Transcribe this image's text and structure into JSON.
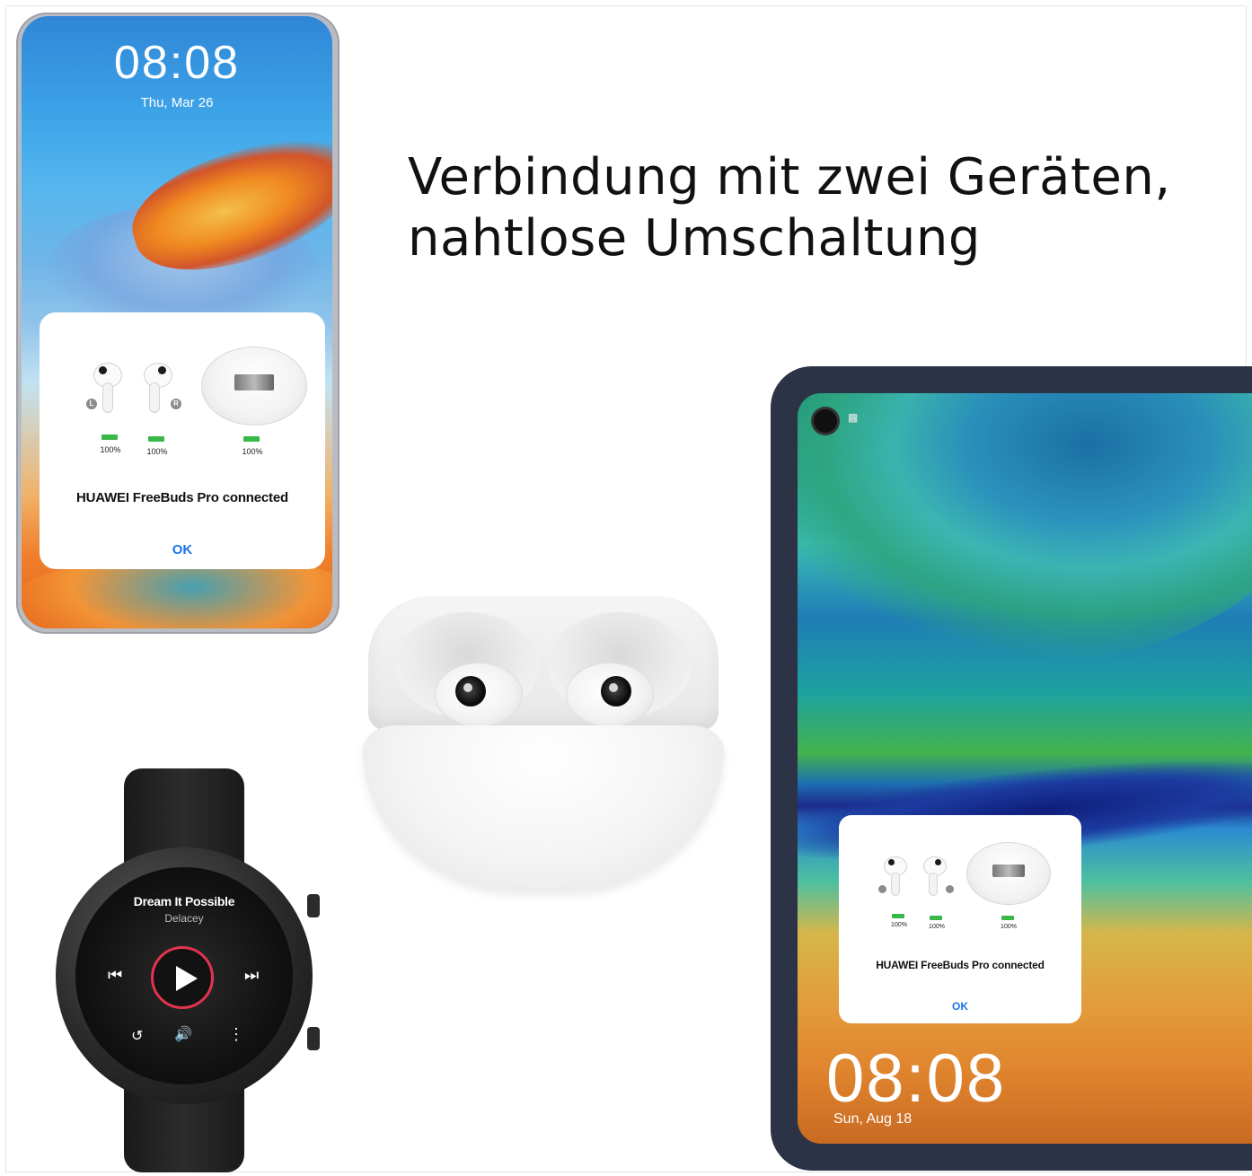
{
  "headline": {
    "line1": "Verbindung mit zwei Geräten,",
    "line2": "nahtlose Umschaltung"
  },
  "phone": {
    "time": "08:08",
    "date": "Thu, Mar 26",
    "dialog": {
      "left_tag": "L",
      "right_tag": "R",
      "battery_left": "100%",
      "battery_right": "100%",
      "battery_case": "100%",
      "message": "HUAWEI FreeBuds Pro connected",
      "ok": "OK"
    }
  },
  "watch": {
    "song": "Dream It Possible",
    "artist": "Delacey",
    "prev_icon": "previous-track-icon",
    "next_icon": "next-track-icon",
    "play_icon": "play-icon",
    "repeat_icon": "repeat-icon",
    "volume_icon": "volume-icon",
    "more_icon": "more-vertical-icon",
    "accent": "#e3344f"
  },
  "tablet": {
    "time": "08:08",
    "date": "Sun, Aug 18",
    "dialog": {
      "battery_left": "100%",
      "battery_right": "100%",
      "battery_case": "100%",
      "message": "HUAWEI FreeBuds Pro connected",
      "ok": "OK"
    }
  },
  "colors": {
    "ok_blue": "#1a73e8",
    "battery_green": "#39b84a",
    "tablet_bezel": "#2d3347"
  }
}
